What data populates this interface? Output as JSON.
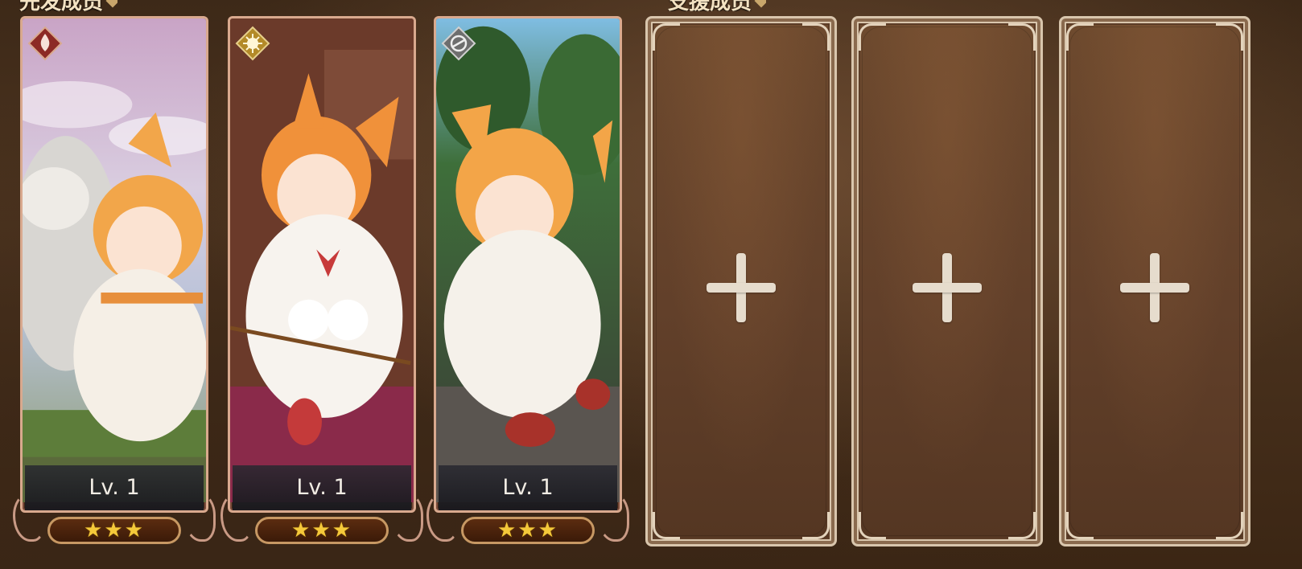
{
  "sections": {
    "starting_members": "先发成员",
    "support_members": "支援成员"
  },
  "heroes": [
    {
      "element": "fire-element-icon",
      "element_color": "#8c2a25",
      "level": "Lv. 1",
      "stars": "★★★"
    },
    {
      "element": "light-element-icon",
      "element_color": "#b38a28",
      "level": "Lv. 1",
      "stars": "★★★"
    },
    {
      "element": "wind-element-icon",
      "element_color": "#6e6e6e",
      "level": "Lv. 1",
      "stars": "★★★"
    }
  ],
  "support_slots": [
    {
      "icon": "plus-icon"
    },
    {
      "icon": "plus-icon"
    },
    {
      "icon": "plus-icon"
    }
  ],
  "colors": {
    "card_border": "#d9a98e",
    "slot_border": "#d9c6ad",
    "star": "#f4c93a"
  }
}
